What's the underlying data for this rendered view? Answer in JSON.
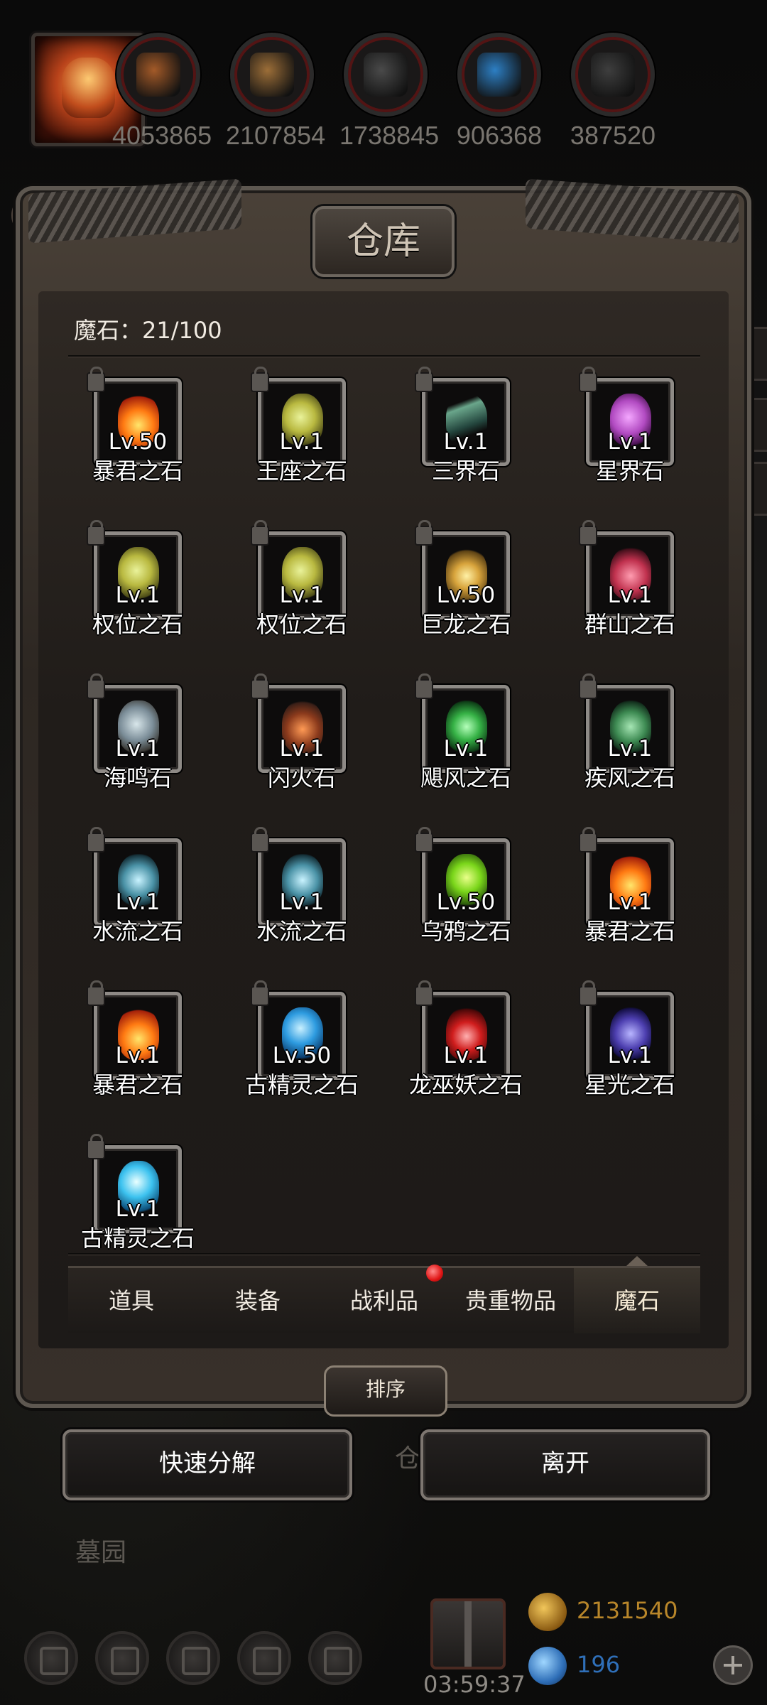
{
  "resources": [
    {
      "icon": "wood-log-icon",
      "value": "4053865",
      "color": "#a35a28"
    },
    {
      "icon": "wooden-plank-icon",
      "value": "2107854",
      "color": "#9c6e38"
    },
    {
      "icon": "iron-ingot-icon",
      "value": "1738845",
      "color": "#4a4a4a"
    },
    {
      "icon": "blue-crystal-icon",
      "value": "906368",
      "color": "#2d7fc4"
    },
    {
      "icon": "dark-ingot-icon",
      "value": "387520",
      "color": "#3e3e3e"
    }
  ],
  "panel": {
    "title": "仓库",
    "capacity_label": "魔石：21/100"
  },
  "stones": [
    {
      "name": "暴君之石",
      "level": "Lv.50",
      "gem": "g-fire"
    },
    {
      "name": "王座之石",
      "level": "Lv.1",
      "gem": "g-yellow"
    },
    {
      "name": "三界石",
      "level": "Lv.1",
      "gem": "g-shard"
    },
    {
      "name": "星界石",
      "level": "Lv.1",
      "gem": "g-pink"
    },
    {
      "name": "权位之石",
      "level": "Lv.1",
      "gem": "g-yellow"
    },
    {
      "name": "权位之石",
      "level": "Lv.1",
      "gem": "g-yellow"
    },
    {
      "name": "巨龙之石",
      "level": "Lv.50",
      "gem": "g-dragon"
    },
    {
      "name": "群山之石",
      "level": "Lv.1",
      "gem": "g-rose"
    },
    {
      "name": "海鸣石",
      "level": "Lv.1",
      "gem": "g-rockblue"
    },
    {
      "name": "闪火石",
      "level": "Lv.1",
      "gem": "g-lava"
    },
    {
      "name": "飓风之石",
      "level": "Lv.1",
      "gem": "g-green"
    },
    {
      "name": "疾风之石",
      "level": "Lv.1",
      "gem": "g-dgreen"
    },
    {
      "name": "水流之石",
      "level": "Lv.1",
      "gem": "g-aqua"
    },
    {
      "name": "水流之石",
      "level": "Lv.1",
      "gem": "g-aqua"
    },
    {
      "name": "乌鸦之石",
      "level": "Lv.50",
      "gem": "g-lime"
    },
    {
      "name": "暴君之石",
      "level": "Lv.1",
      "gem": "g-fire"
    },
    {
      "name": "暴君之石",
      "level": "Lv.1",
      "gem": "g-fire"
    },
    {
      "name": "古精灵之石",
      "level": "Lv.50",
      "gem": "g-orb"
    },
    {
      "name": "龙巫妖之石",
      "level": "Lv.1",
      "gem": "g-red"
    },
    {
      "name": "星光之石",
      "level": "Lv.1",
      "gem": "g-purple"
    },
    {
      "name": "古精灵之石",
      "level": "Lv.1",
      "gem": "g-iceorb"
    }
  ],
  "tabs": [
    {
      "label": "道具",
      "active": false
    },
    {
      "label": "装备",
      "active": false
    },
    {
      "label": "战利品",
      "active": false,
      "badge": true
    },
    {
      "label": "贵重物品",
      "active": false
    },
    {
      "label": "魔石",
      "active": true
    }
  ],
  "sort_label": "排序",
  "actions": {
    "quick_decompose": "快速分解",
    "leave": "离开"
  },
  "background": {
    "ghost_label": "仓",
    "graveyard": "墓园"
  },
  "bottom": {
    "timer": "03:59:37",
    "gold": {
      "value": "2131540",
      "color": "#b8862a"
    },
    "gems": {
      "value": "196",
      "color": "#2f6fb8"
    }
  }
}
